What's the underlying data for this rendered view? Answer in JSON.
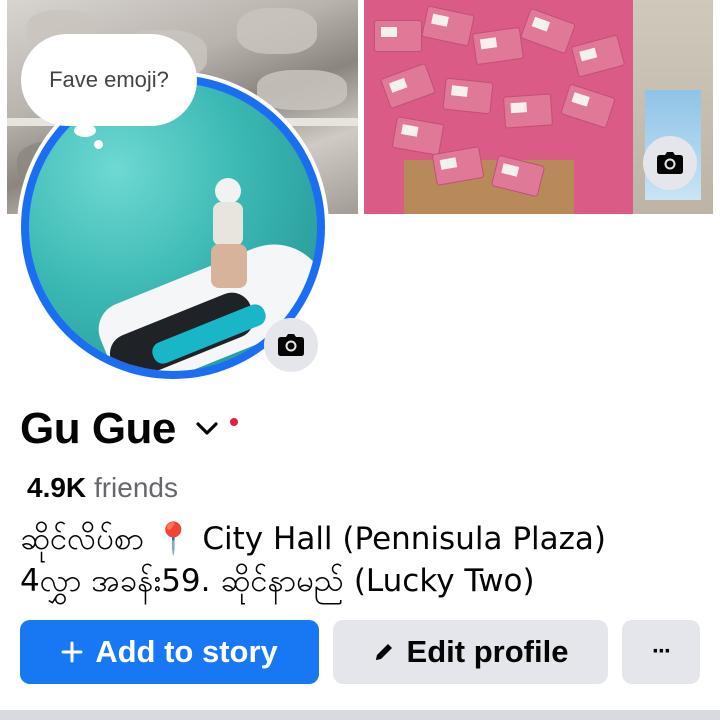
{
  "profile": {
    "name": "Gu Gue",
    "friends_count": "4.9K",
    "friends_label": "friends",
    "bio_line1": "ဆိုင်လိပ်စာ 📍 City Hall (Pennisula Plaza)",
    "bio_line2": "4လွှာ အခန်း59.  ဆိုင်နာမည် (Lucky Two)"
  },
  "avatar": {
    "note_bubble_text": "Fave emoji?"
  },
  "actions": {
    "add_story_label": "Add to story",
    "add_story_icon": "plus-icon",
    "edit_profile_label": "Edit profile",
    "edit_profile_icon": "pencil-icon",
    "more_label": "···"
  },
  "icons": {
    "cover_camera": "camera-icon",
    "avatar_camera": "camera-icon",
    "name_dropdown": "chevron-down-icon"
  },
  "colors": {
    "primary_blue": "#1877f2",
    "avatar_ring_blue": "#1b6ef3",
    "notification_red": "#e41e3f",
    "secondary_button": "#e4e6eb"
  }
}
